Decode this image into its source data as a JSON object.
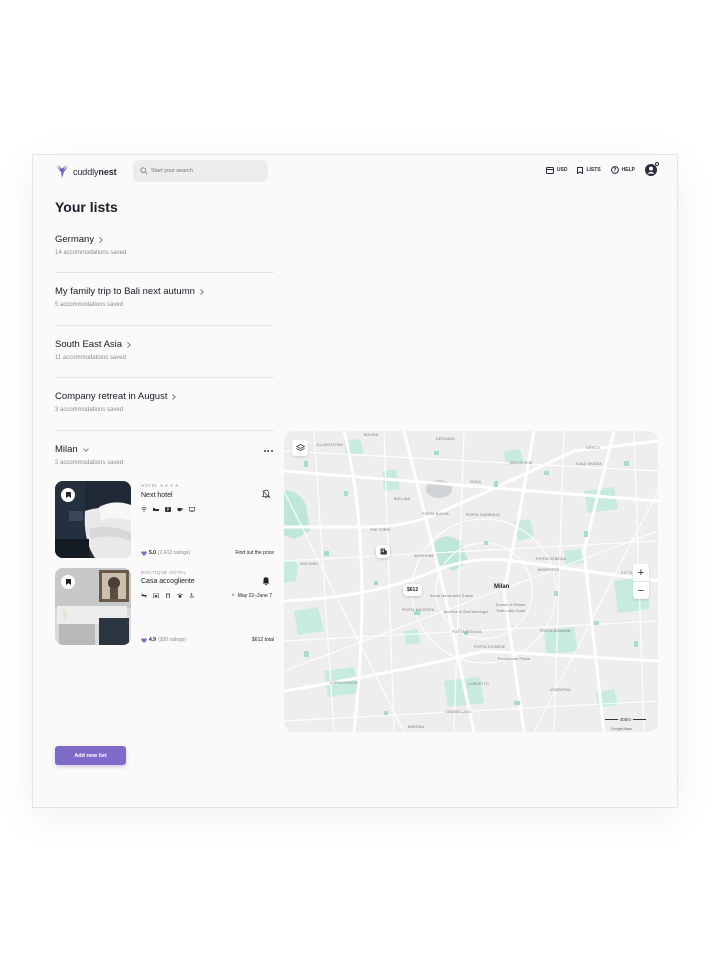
{
  "header": {
    "logo_light": "cuddly",
    "logo_bold": "nest",
    "search_placeholder": "Start your search",
    "nav": {
      "currency": "USD",
      "lists": "LISTS",
      "help": "HELP"
    }
  },
  "page_title": "Your lists",
  "lists": [
    {
      "name": "Germany",
      "count": "14 accommodations saved"
    },
    {
      "name": "My family trip to Bali next autumn",
      "count": "5 accommodations saved"
    },
    {
      "name": "South East Asia",
      "count": "11 accommodations saved"
    },
    {
      "name": "Company retreat in August",
      "count": "3 accommodations saved"
    }
  ],
  "open_list": {
    "name": "Milan",
    "count": "2 accommodations saved",
    "items": [
      {
        "category": "HOTEL",
        "stars": "★★★★",
        "name": "Next hotel",
        "rating": "5.0",
        "ratings_count": "(2,412 ratings)",
        "price": "Find out the price",
        "alert": "bell-off-icon"
      },
      {
        "category": "BOUTIQUE HOTEL",
        "stars": "",
        "name": "Casa accogliente",
        "rating": "4.9",
        "ratings_count": "(300 ratings)",
        "price": "$612 total",
        "dates": "May 22–June 7",
        "alert": "bell-icon"
      }
    ]
  },
  "map": {
    "city_label": "Milan",
    "price_pin": "$612",
    "scale": "400m",
    "attribution": "Google Maps",
    "labels": [
      "BOVISA",
      "VILLAPIZZONE",
      "DERGANO",
      "MACIACHINI",
      "BOLLINA",
      "ISOLA",
      "GRECO",
      "VIALE MONZA",
      "TRE TORRI",
      "PORTA NUOVA",
      "PORTA GARIBALDI",
      "SEMPIONE",
      "PORTA VENEZIA",
      "CITTÀ STUDI",
      "MONFORTE",
      "SAN SIRO",
      "PORTA MAGENTA",
      "PORTA GENOVA",
      "PORTA ROMANA",
      "PORTA TICINESE",
      "LORENTEGGIO",
      "CORVETTO",
      "VIGENTINA",
      "BARONA",
      "GIAMBELLINO",
      "Santa Maria delle Grazie",
      "Basilica di Sant'Ambrogio",
      "Teatro alla Scala",
      "Duomo di Milano",
      "Fondazione Prada"
    ]
  },
  "add_button": "Add new list"
}
